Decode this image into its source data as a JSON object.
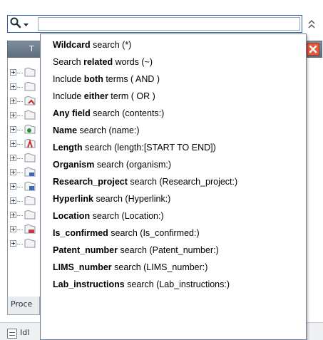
{
  "search": {
    "value": "",
    "placeholder": ""
  },
  "panel": {
    "title_fragment": "T",
    "tabs": [
      "Proce"
    ]
  },
  "status": {
    "text": "Idl"
  },
  "menu": {
    "items": [
      {
        "bold": "Wildcard",
        "rest": " search (*)"
      },
      {
        "pre": "Search ",
        "bold": "related",
        "rest": " words (~)"
      },
      {
        "pre": "Include ",
        "bold": "both",
        "rest": " terms ( AND )"
      },
      {
        "pre": "Include ",
        "bold": "either",
        "rest": " term ( OR )"
      },
      {
        "bold": "Any field",
        "rest": " search (contents:)"
      },
      {
        "bold": "Name",
        "rest": " search (name:)"
      },
      {
        "bold": "Length",
        "rest": " search (length:[START TO END])"
      },
      {
        "bold": "Organism",
        "rest": " search (organism:)"
      },
      {
        "bold": "Research_project",
        "rest": " search (Research_project:)"
      },
      {
        "bold": "Hyperlink",
        "rest": " search (Hyperlink:)"
      },
      {
        "bold": "Location",
        "rest": " search (Location:)"
      },
      {
        "bold": "Is_confirmed",
        "rest": " search (Is_confirmed:)"
      },
      {
        "bold": "Patent_number",
        "rest": " search (Patent_number:)"
      },
      {
        "bold": "LIMS_number",
        "rest": " search (LIMS_number:)"
      },
      {
        "bold": "Lab_instructions",
        "rest": " search (Lab_instructions:)"
      }
    ]
  },
  "colors": {
    "accent": "#2c5fa7",
    "panel_header": "#6e7d90",
    "close_button": "#e35a3c",
    "menu_border": "#6f7f91"
  },
  "icons": {
    "search": "search-magnifier-dropdown-icon",
    "collapse": "double-chevron-up-icon",
    "close": "close-icon",
    "status": "status-panel-icon"
  }
}
